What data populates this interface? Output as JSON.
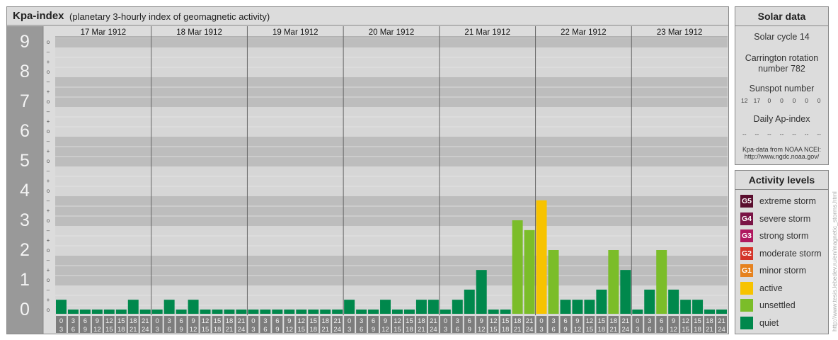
{
  "header": {
    "title": "Kpa-index",
    "subtitle": "(planetary 3-hourly index of geomagnetic activity)"
  },
  "solar_panel": {
    "title": "Solar data",
    "solar_cycle": "Solar cycle 14",
    "carrington_line1": "Carrington rotation",
    "carrington_line2": "number 782",
    "sunspot_title": "Sunspot number",
    "sunspot_values": [
      "12",
      "17",
      "0",
      "0",
      "0",
      "0",
      "0"
    ],
    "ap_title": "Daily Ap-index",
    "ap_values": [
      "--",
      "--",
      "--",
      "--",
      "--",
      "--",
      "--"
    ],
    "source_line1": "Kpa-data from NOAA NCEI:",
    "source_line2": "http://www.ngdc.noaa.gov/"
  },
  "activity_panel": {
    "title": "Activity levels",
    "levels": [
      {
        "badge": "G5",
        "label": "extreme storm",
        "color": "#5a0e2e"
      },
      {
        "badge": "G4",
        "label": "severe storm",
        "color": "#7a1446"
      },
      {
        "badge": "G3",
        "label": "strong storm",
        "color": "#b0185f"
      },
      {
        "badge": "G2",
        "label": "moderate storm",
        "color": "#d4352a"
      },
      {
        "badge": "G1",
        "label": "minor storm",
        "color": "#e6821e"
      },
      {
        "badge": "",
        "label": "active",
        "color": "#f7c300"
      },
      {
        "badge": "",
        "label": "unsettled",
        "color": "#7bbd29"
      },
      {
        "badge": "",
        "label": "quiet",
        "color": "#00884c"
      }
    ]
  },
  "watermark": "http://www.tesis.lebedev.ru/en/magnetic_storms.html",
  "chart_data": {
    "type": "bar",
    "title": "Kpa-index",
    "subtitle": "(planetary 3-hourly index of geomagnetic activity)",
    "ylim": [
      0,
      9
    ],
    "y_ticks": [
      "0",
      "1",
      "2",
      "3",
      "4",
      "5",
      "6",
      "7",
      "8",
      "9"
    ],
    "sub_ticks": [
      "o",
      "+",
      "–"
    ],
    "days": [
      "17 Mar 1912",
      "18 Mar 1912",
      "19 Mar 1912",
      "20 Mar 1912",
      "21 Mar 1912",
      "22 Mar 1912",
      "23 Mar 1912"
    ],
    "interval_start": [
      "0",
      "3",
      "6",
      "9",
      "12",
      "15",
      "18",
      "21"
    ],
    "interval_end": [
      "3",
      "6",
      "9",
      "12",
      "15",
      "18",
      "21",
      "24"
    ],
    "values": [
      [
        0.33,
        0,
        0,
        0,
        0,
        0,
        0.33,
        0
      ],
      [
        0,
        0.33,
        0,
        0.33,
        0,
        0,
        0,
        0
      ],
      [
        0,
        0,
        0,
        0,
        0,
        0,
        0,
        0
      ],
      [
        0.33,
        0,
        0,
        0.33,
        0,
        0,
        0.33,
        0.33
      ],
      [
        0,
        0.33,
        0.67,
        1.33,
        0,
        0,
        3.0,
        2.67
      ],
      [
        3.67,
        2.0,
        0.33,
        0.33,
        0.33,
        0.67,
        2.0,
        1.33
      ],
      [
        0,
        0.67,
        2.0,
        0.67,
        0.33,
        0.33,
        0,
        0
      ]
    ],
    "level_colors": {
      "quiet": "#00884c",
      "unsettled": "#7bbd29",
      "active": "#f7c300"
    },
    "grid": true
  }
}
